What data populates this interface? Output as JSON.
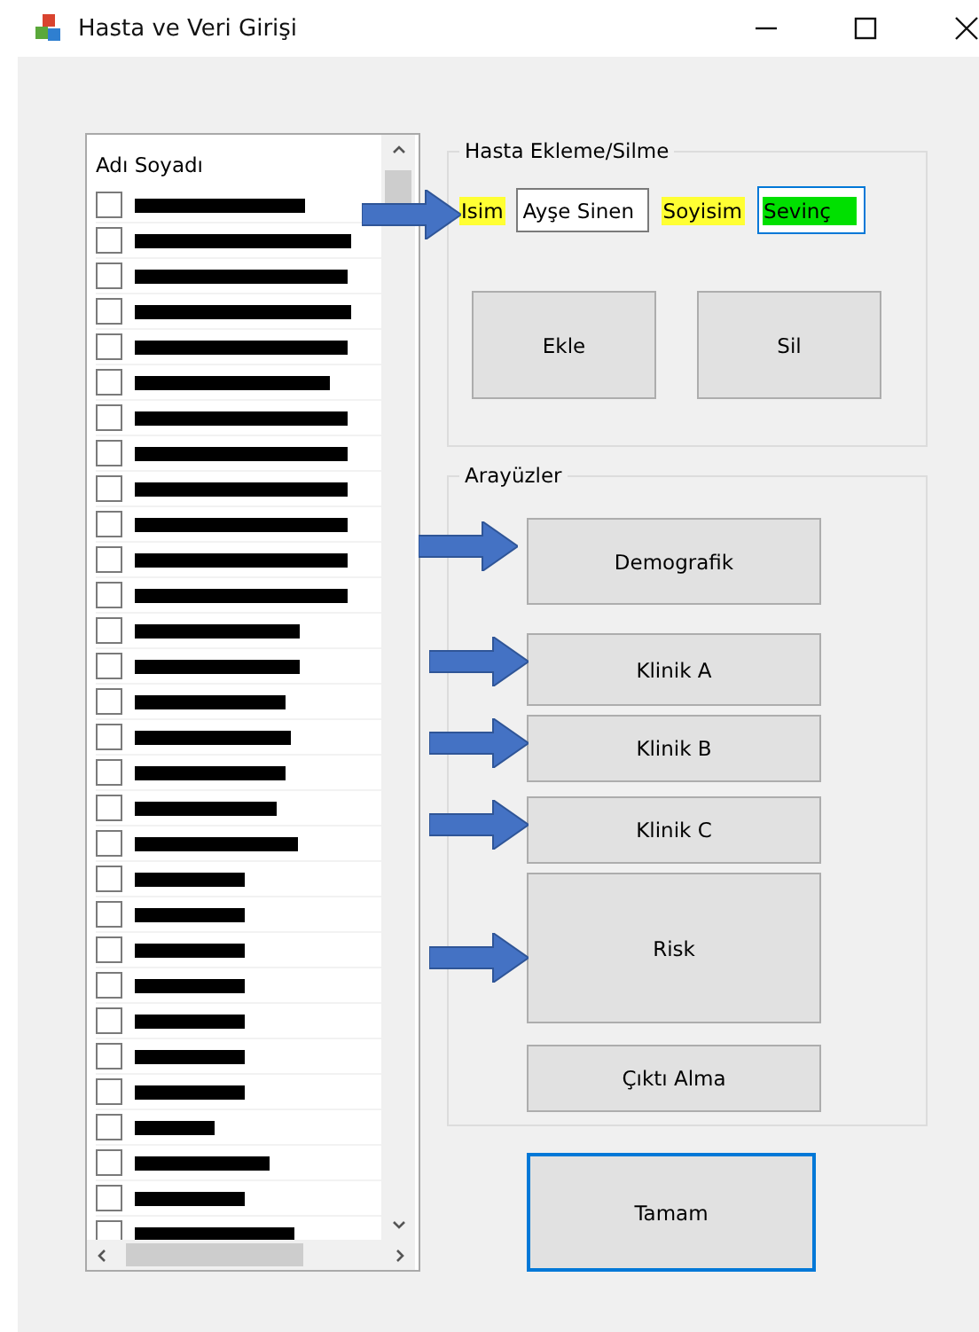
{
  "window": {
    "title": "Hasta ve Veri Girişi"
  },
  "patient_list": {
    "header": "Adı Soyadı",
    "items": [
      {
        "checked": false
      },
      {
        "checked": false
      },
      {
        "checked": false
      },
      {
        "checked": false
      },
      {
        "checked": false
      },
      {
        "checked": false
      },
      {
        "checked": false
      },
      {
        "checked": false
      },
      {
        "checked": false
      },
      {
        "checked": false
      },
      {
        "checked": false
      },
      {
        "checked": false
      },
      {
        "checked": false
      },
      {
        "checked": false
      },
      {
        "checked": false
      },
      {
        "checked": false
      },
      {
        "checked": false
      },
      {
        "checked": false
      },
      {
        "checked": false
      },
      {
        "checked": false
      },
      {
        "checked": false
      },
      {
        "checked": false
      },
      {
        "checked": false
      },
      {
        "checked": false
      },
      {
        "checked": false
      },
      {
        "checked": false
      },
      {
        "checked": false
      },
      {
        "checked": false
      },
      {
        "checked": false
      },
      {
        "checked": false
      }
    ]
  },
  "add_remove_group": {
    "title": "Hasta Ekleme/Silme",
    "arrow": true,
    "name_label": "Isim",
    "name_value": "Ayşe Sinen",
    "surname_label": "Soyisim",
    "surname_value": "Sevinç",
    "surname_focused": true,
    "buttons": [
      "Ekle",
      "Sil"
    ]
  },
  "interfaces_group": {
    "title": "Arayüzler",
    "buttons": [
      {
        "label": "Demografik",
        "arrow": true
      },
      {
        "label": "Klinik A",
        "arrow": true
      },
      {
        "label": "Klinik B",
        "arrow": true
      },
      {
        "label": "Klinik C",
        "arrow": true
      },
      {
        "label": "Risk",
        "arrow": true
      },
      {
        "label": "Çıktı Alma",
        "arrow": false
      }
    ]
  },
  "ok_button": {
    "label": "Tamam",
    "default": true
  }
}
